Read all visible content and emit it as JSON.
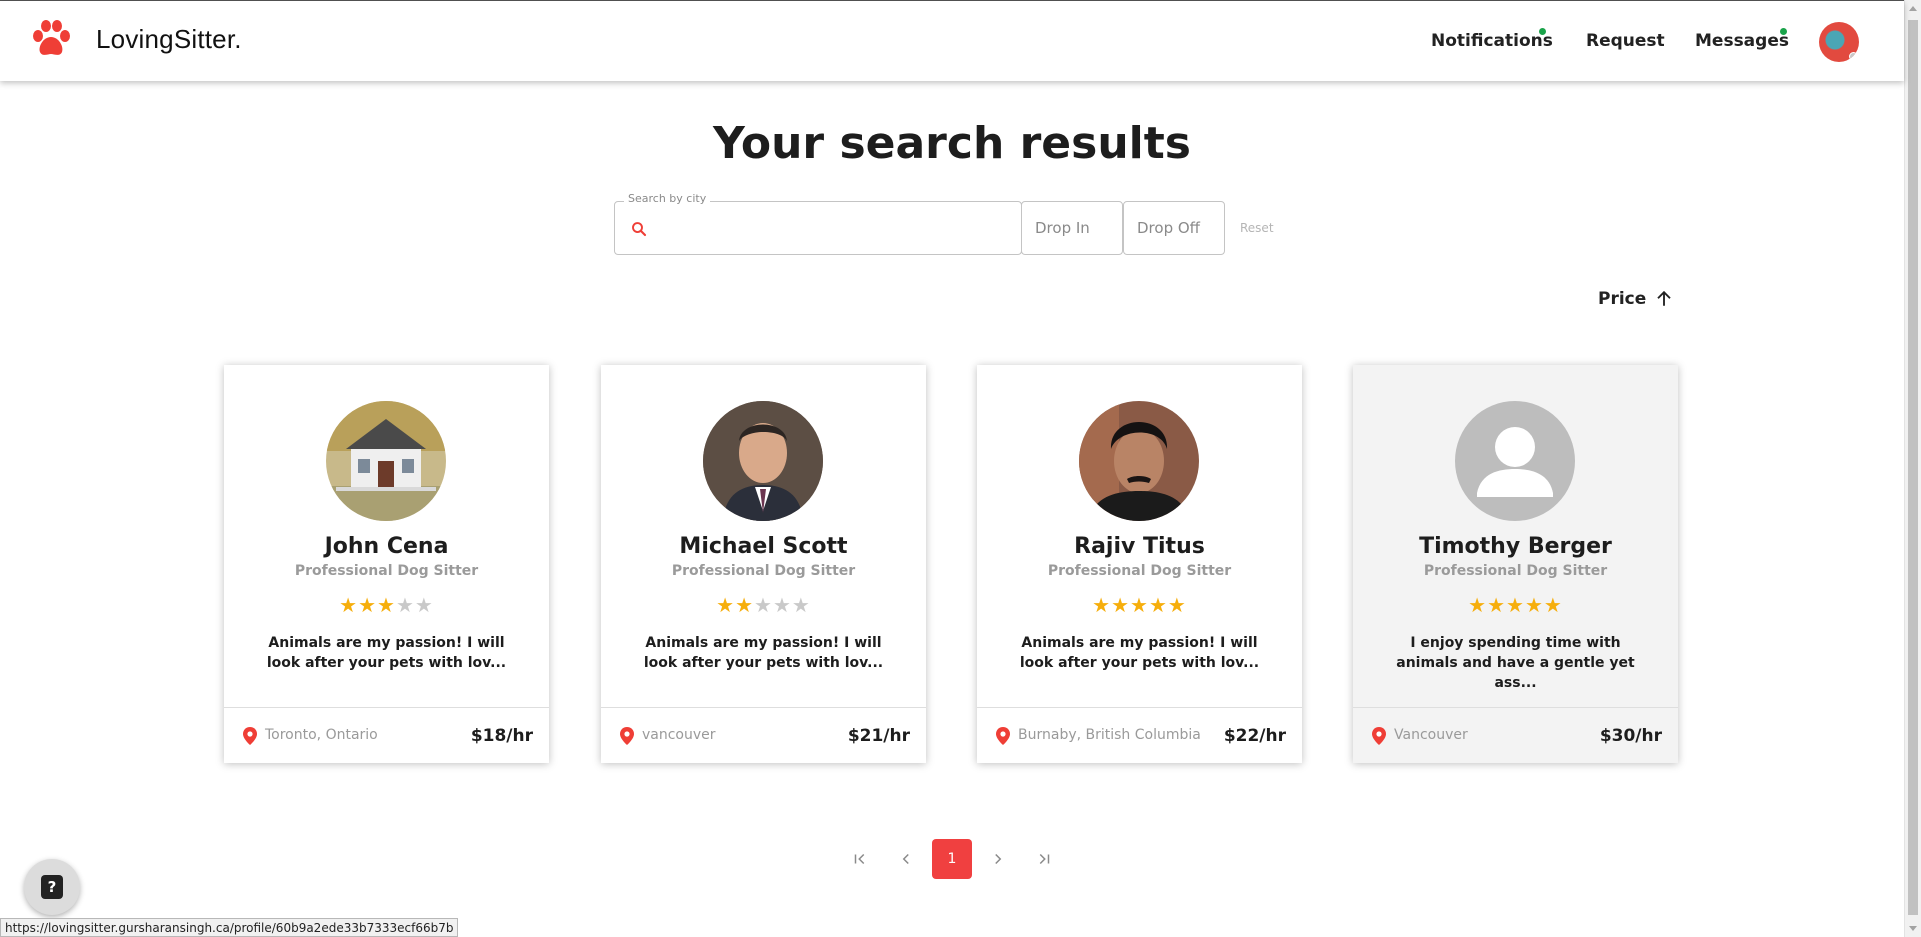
{
  "app": {
    "brand": "LovingSitter."
  },
  "nav": {
    "notifications": "Notifications",
    "request": "Request",
    "messages": "Messages"
  },
  "page": {
    "title": "Your search results"
  },
  "search": {
    "legend": "Search by city",
    "value": "",
    "drop_in": "Drop In",
    "drop_off": "Drop Off",
    "reset": "Reset"
  },
  "sort": {
    "label": "Price",
    "direction": "ascending"
  },
  "sitters": [
    {
      "name": "John Cena",
      "role": "Professional Dog Sitter",
      "rating": 3,
      "rating_max": 5,
      "description": "Animals are my passion! I will look after your pets with lov...",
      "location": "Toronto, Ontario",
      "rate": "$18/hr"
    },
    {
      "name": "Michael Scott",
      "role": "Professional Dog Sitter",
      "rating": 2,
      "rating_max": 5,
      "description": "Animals are my passion! I will look after your pets with lov...",
      "location": "vancouver",
      "rate": "$21/hr"
    },
    {
      "name": "Rajiv Titus",
      "role": "Professional Dog Sitter",
      "rating": 5,
      "rating_max": 5,
      "description": "Animals are my passion! I will look after your pets with lov...",
      "location": "Burnaby, British Columbia",
      "rate": "$22/hr"
    },
    {
      "name": "Timothy Berger",
      "role": "Professional Dog Sitter",
      "rating": 5,
      "rating_max": 5,
      "description": "I enjoy spending time with animals and have a gentle yet ass...",
      "location": "Vancouver",
      "rate": "$30/hr"
    }
  ],
  "pagination": {
    "current_page": "1"
  },
  "status_bar": {
    "url": "https://lovingsitter.gursharansingh.ca/profile/60b9a2ede33b7333ecf66b7b"
  },
  "colors": {
    "accent": "#f04040",
    "star": "#f6ae0c",
    "online_dot": "#1aa34a"
  },
  "icons": {
    "logo": "paw-icon",
    "search": "search-icon",
    "sort": "arrow-up-icon",
    "location": "location-pin-icon",
    "help": "help-icon"
  }
}
